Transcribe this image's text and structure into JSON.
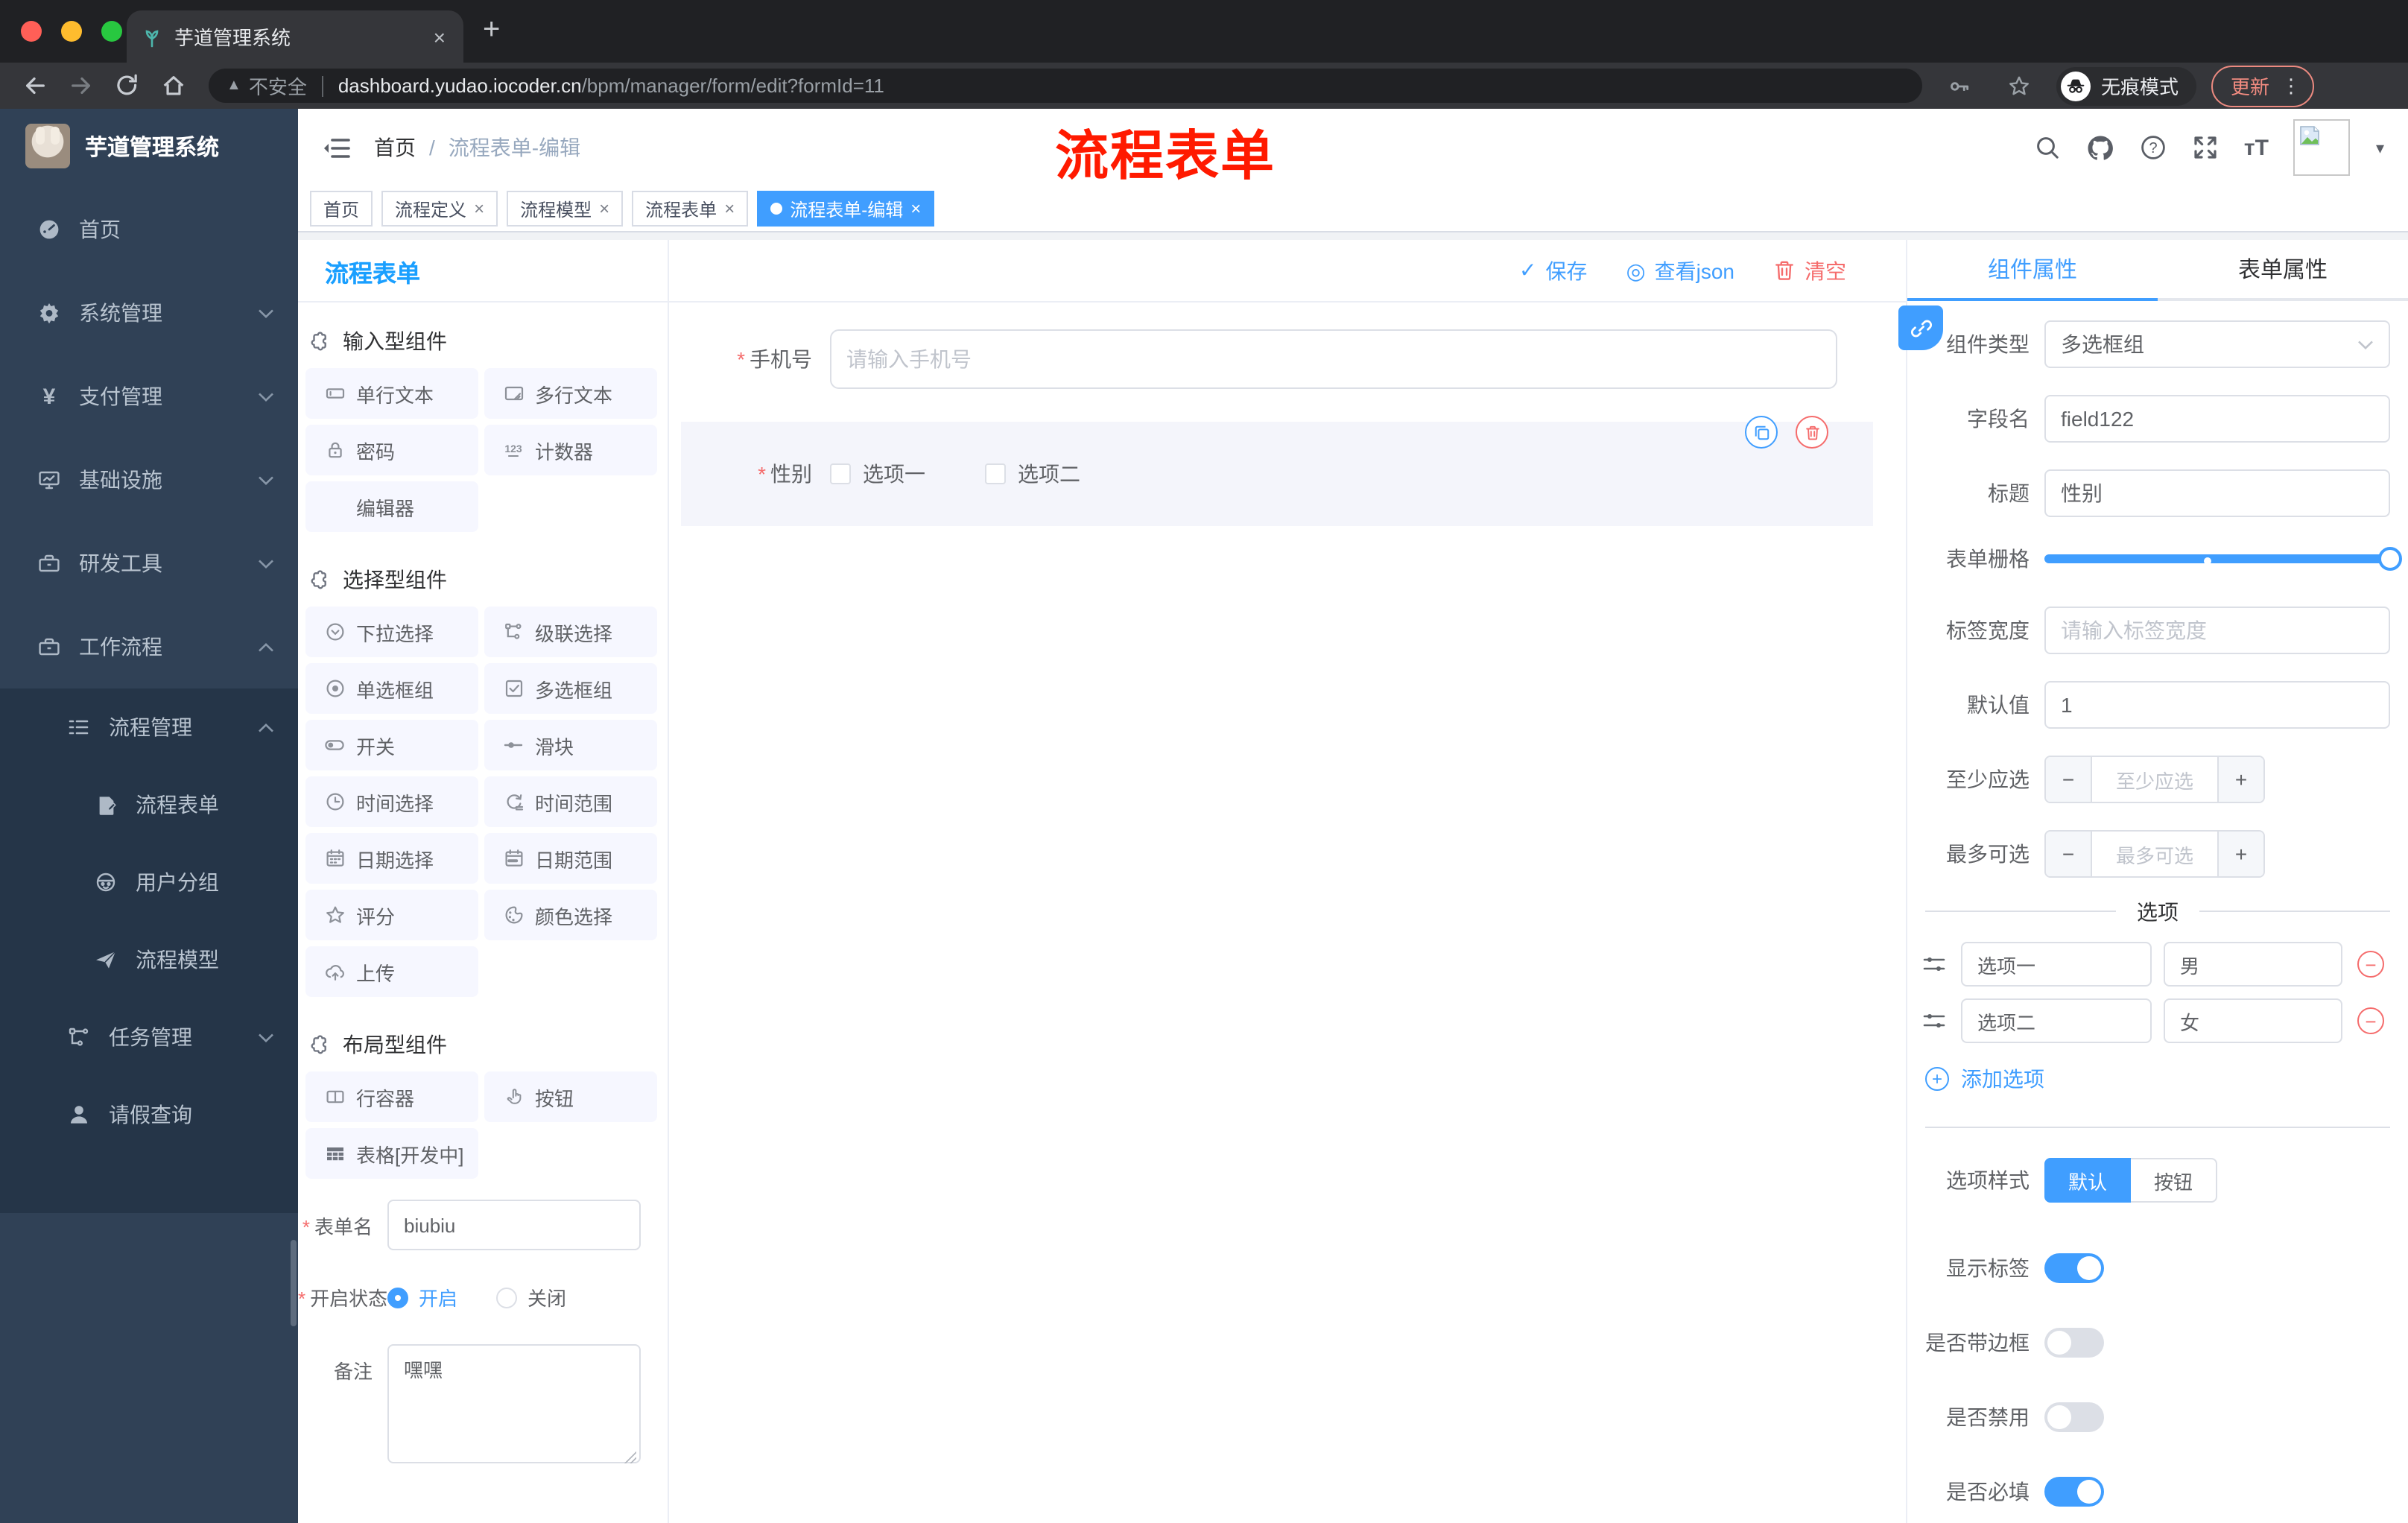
{
  "browser": {
    "tab_title": "芋道管理系统",
    "security_label": "不安全",
    "url_host": "dashboard.yudao.iocoder.cn",
    "url_path": "/bpm/manager/form/edit?formId=11",
    "incognito_label": "无痕模式",
    "update_label": "更新"
  },
  "icons": {
    "close": "×",
    "plus": "+",
    "check": "✓",
    "view_json": "◎",
    "caret_down": "▾",
    "dots_vertical": "⋮",
    "asterisk": "*",
    "breadcrumb_sep": "/",
    "warning": "▲",
    "minus": "−",
    "star": "☆"
  },
  "sidebar": {
    "brand": "芋道管理系统",
    "items": [
      {
        "label": "首页"
      },
      {
        "label": "系统管理"
      },
      {
        "label": "支付管理"
      },
      {
        "label": "基础设施"
      },
      {
        "label": "研发工具"
      },
      {
        "label": "工作流程"
      }
    ],
    "sub": {
      "label": "流程管理",
      "children": [
        {
          "label": "流程表单"
        },
        {
          "label": "用户分组"
        },
        {
          "label": "流程模型"
        }
      ]
    },
    "tail": [
      {
        "label": "任务管理"
      },
      {
        "label": "请假查询"
      }
    ]
  },
  "header": {
    "breadcrumb_home": "首页",
    "breadcrumb_current": "流程表单-编辑",
    "annotation": "流程表单",
    "annotation_color": "#ff1a00"
  },
  "tags": {
    "items": [
      {
        "label": "首页"
      },
      {
        "label": "流程定义"
      },
      {
        "label": "流程模型"
      },
      {
        "label": "流程表单"
      },
      {
        "label": "流程表单-编辑"
      }
    ]
  },
  "editor": {
    "title": "流程表单",
    "save": "保存",
    "view_json": "查看json",
    "clear": "清空"
  },
  "palette": {
    "sections": [
      {
        "title": "输入型组件",
        "items": [
          {
            "label": "单行文本"
          },
          {
            "label": "多行文本"
          },
          {
            "label": "密码"
          },
          {
            "label": "计数器"
          },
          {
            "label": "编辑器"
          }
        ]
      },
      {
        "title": "选择型组件",
        "items": [
          {
            "label": "下拉选择"
          },
          {
            "label": "级联选择"
          },
          {
            "label": "单选框组"
          },
          {
            "label": "多选框组"
          },
          {
            "label": "开关"
          },
          {
            "label": "滑块"
          },
          {
            "label": "时间选择"
          },
          {
            "label": "时间范围"
          },
          {
            "label": "日期选择"
          },
          {
            "label": "日期范围"
          },
          {
            "label": "评分"
          },
          {
            "label": "颜色选择"
          },
          {
            "label": "上传"
          }
        ]
      },
      {
        "title": "布局型组件",
        "items": [
          {
            "label": "行容器"
          },
          {
            "label": "按钮"
          },
          {
            "label": "表格[开发中]"
          }
        ]
      }
    ]
  },
  "meta": {
    "name_label": "表单名",
    "name_value": "biubiu",
    "status_label": "开启状态",
    "status_on": "开启",
    "status_off": "关闭",
    "remark_label": "备注",
    "remark_value": "嘿嘿"
  },
  "canvas": {
    "phone_label": "手机号",
    "phone_placeholder": "请输入手机号",
    "gender_label": "性别",
    "option1": "选项一",
    "option2": "选项二"
  },
  "props": {
    "tab_component": "组件属性",
    "tab_form": "表单属性",
    "type_label": "组件类型",
    "type_value": "多选框组",
    "field_label": "字段名",
    "field_value": "field122",
    "title_label": "标题",
    "title_value": "性别",
    "grid_label": "表单栅格",
    "width_label": "标签宽度",
    "width_placeholder": "请输入标签宽度",
    "default_label": "默认值",
    "default_value": "1",
    "min_label": "至少应选",
    "min_placeholder": "至少应选",
    "max_label": "最多可选",
    "max_placeholder": "最多可选",
    "options_title": "选项",
    "options": [
      {
        "label": "选项一",
        "value": "男"
      },
      {
        "label": "选项二",
        "value": "女"
      }
    ],
    "add_option": "添加选项",
    "style_label": "选项样式",
    "style_default": "默认",
    "style_button": "按钮",
    "toggles": [
      {
        "label": "显示标签",
        "on": true
      },
      {
        "label": "是否带边框",
        "on": false
      },
      {
        "label": "是否禁用",
        "on": false
      },
      {
        "label": "是否必填",
        "on": true
      }
    ]
  },
  "colors": {
    "primary": "#409EFF",
    "danger": "#F56C6C",
    "sidebar": "#304156",
    "annotation": "#FF1A00"
  }
}
